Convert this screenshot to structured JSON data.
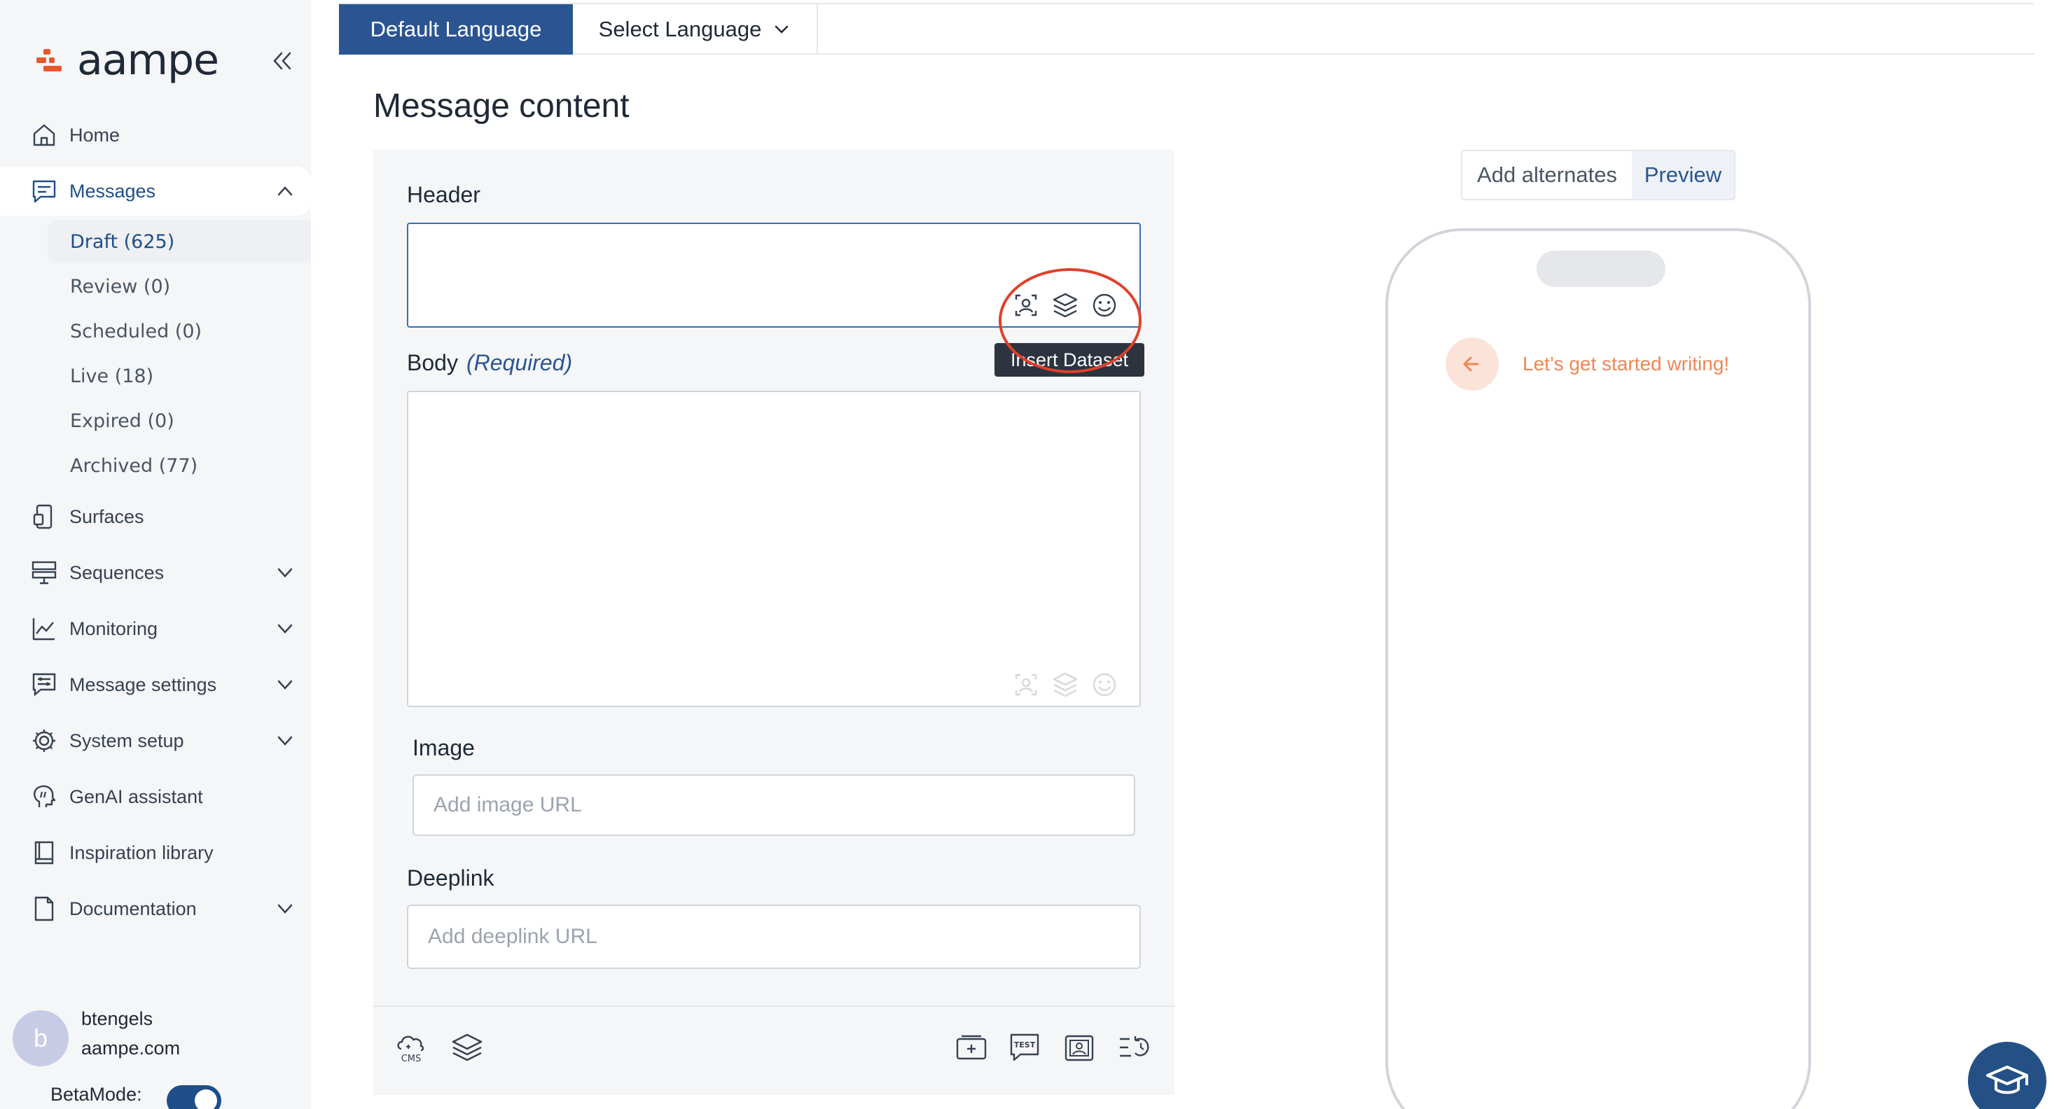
{
  "app": {
    "logo_text": "aampe",
    "brand_color": "#e8582c",
    "primary_color": "#2b5591"
  },
  "sidebar": {
    "items": [
      {
        "label": "Home",
        "icon": "home-icon"
      },
      {
        "label": "Messages",
        "icon": "messages-icon",
        "expanded": true
      },
      {
        "label": "Surfaces",
        "icon": "surfaces-icon"
      },
      {
        "label": "Sequences",
        "icon": "sequences-icon"
      },
      {
        "label": "Monitoring",
        "icon": "monitoring-icon"
      },
      {
        "label": "Message settings",
        "icon": "message-settings-icon"
      },
      {
        "label": "System setup",
        "icon": "gear-icon"
      },
      {
        "label": "GenAI assistant",
        "icon": "genai-icon"
      },
      {
        "label": "Inspiration library",
        "icon": "book-icon"
      },
      {
        "label": "Documentation",
        "icon": "document-icon"
      }
    ],
    "sub_items": [
      {
        "label": "Draft (625)",
        "selected": true
      },
      {
        "label": "Review (0)"
      },
      {
        "label": "Scheduled (0)"
      },
      {
        "label": "Live (18)"
      },
      {
        "label": "Expired (0)"
      },
      {
        "label": "Archived (77)"
      }
    ]
  },
  "user": {
    "avatar_letter": "b",
    "name": "btengels",
    "domain": "aampe.com",
    "beta_label": "BetaMode:",
    "beta_on": true
  },
  "tabs": {
    "default_language": "Default Language",
    "select_language": "Select Language"
  },
  "page_title": "Message content",
  "form": {
    "header_label": "Header",
    "body_label": "Body",
    "body_required": "(Required)",
    "image_label": "Image",
    "image_placeholder": "Add image URL",
    "deeplink_label": "Deeplink",
    "deeplink_placeholder": "Add deeplink URL",
    "tooltip": "Insert Dataset"
  },
  "bottom_bar": {
    "cms_label": "CMS",
    "test_label": "TEST"
  },
  "preview": {
    "add_alternates": "Add alternates",
    "preview": "Preview",
    "message": "Let’s get started writing!"
  }
}
